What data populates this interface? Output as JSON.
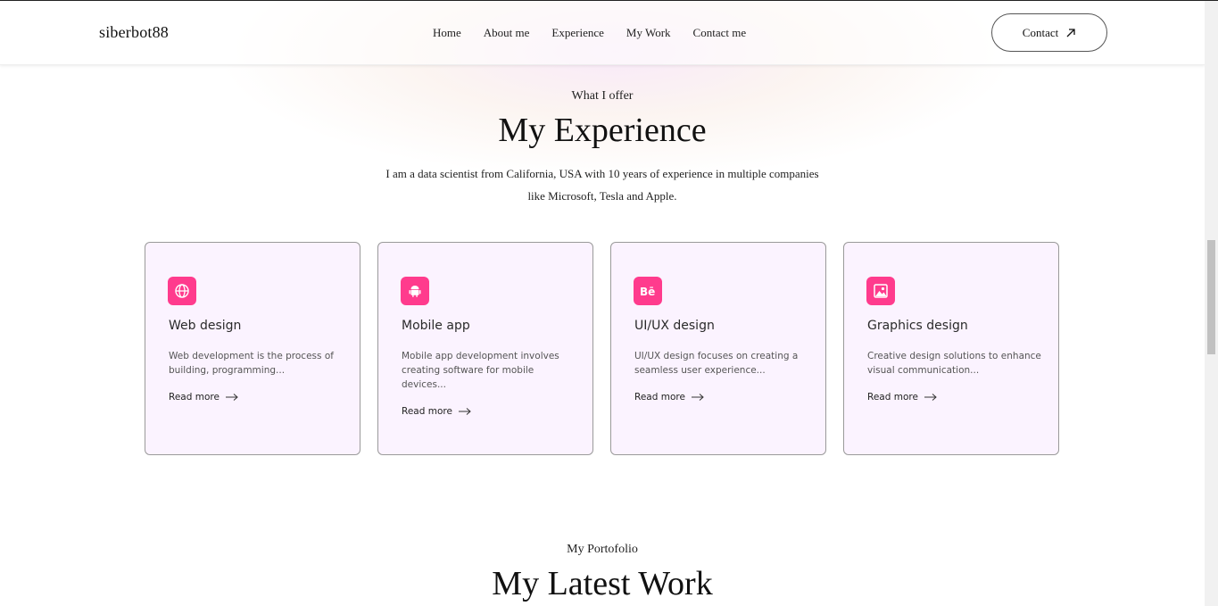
{
  "nav": {
    "logo": "siberbot88",
    "links": [
      "Home",
      "About me",
      "Experience",
      "My Work",
      "Contact me"
    ],
    "contact_label": "Contact"
  },
  "experience": {
    "subtitle": "What I offer",
    "title": "My Experience",
    "intro_line1": "I am a data scientist from California, USA with 10 years of experience in multiple companies",
    "intro_line2": "like Microsoft, Tesla and Apple.",
    "cards": [
      {
        "icon": "globe-icon",
        "title": "Web design",
        "desc": [
          "Web development is the process of",
          "building, programming..."
        ],
        "read_more": "Read more"
      },
      {
        "icon": "android-icon",
        "title": "Mobile app",
        "desc": [
          "Mobile app development involves",
          "creating software for mobile",
          "devices..."
        ],
        "read_more": "Read more"
      },
      {
        "icon": "behance-icon",
        "title": "UI/UX design",
        "desc": [
          "UI/UX design focuses on creating a",
          "seamless user experience..."
        ],
        "read_more": "Read more"
      },
      {
        "icon": "image-icon",
        "title": "Graphics design",
        "desc": [
          "Creative design solutions to enhance",
          "visual communication..."
        ],
        "read_more": "Read more"
      }
    ]
  },
  "portfolio": {
    "subtitle": "My Portofolio",
    "title": "My Latest Work"
  },
  "colors": {
    "accent": "#ff3b8d",
    "card_bg": "#fbf3ff"
  }
}
